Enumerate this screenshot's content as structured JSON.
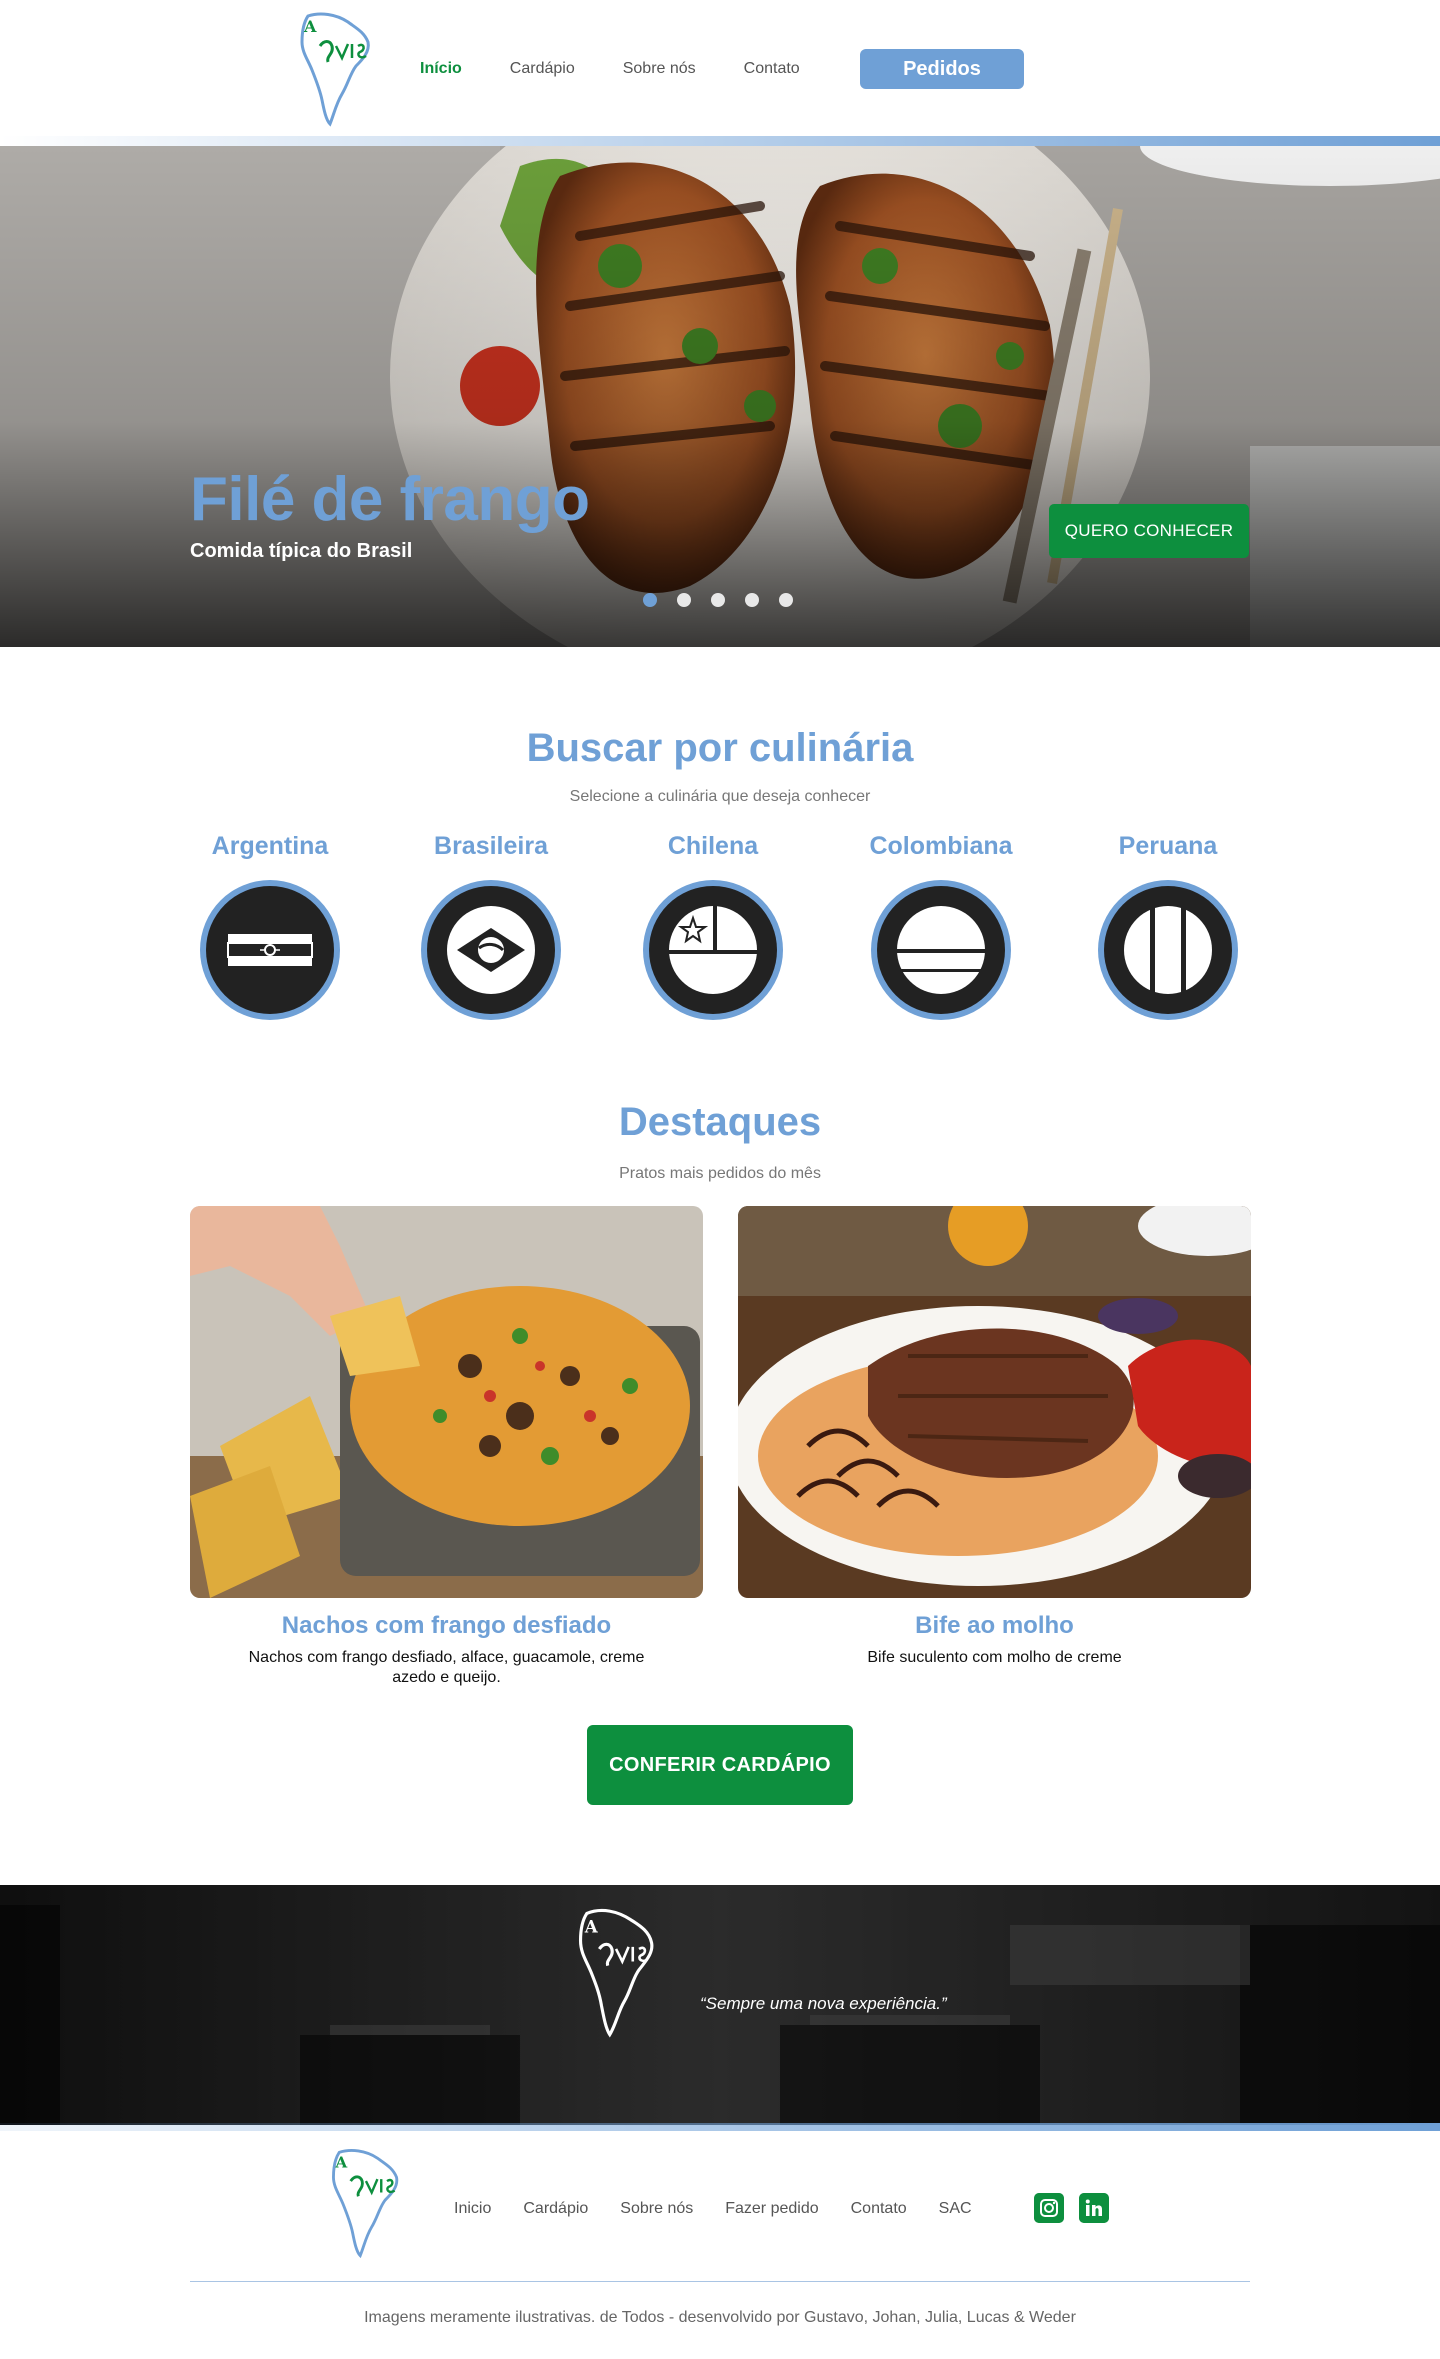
{
  "header": {
    "nav": [
      {
        "label": "Início",
        "active": true
      },
      {
        "label": "Cardápio",
        "active": false
      },
      {
        "label": "Sobre nós",
        "active": false
      },
      {
        "label": "Contato",
        "active": false
      }
    ],
    "orders_button": "Pedidos"
  },
  "hero": {
    "title": "Filé de frango",
    "subtitle": "Comida típica do Brasil",
    "cta": "QUERO CONHECER",
    "slides": 5,
    "active_slide": 1
  },
  "cuisines": {
    "title": "Buscar por culinária",
    "subtitle": "Selecione a culinária que deseja conhecer",
    "items": [
      {
        "label": "Argentina",
        "icon": "argentina-flag-icon"
      },
      {
        "label": "Brasileira",
        "icon": "brazil-flag-icon"
      },
      {
        "label": "Chilena",
        "icon": "chile-flag-icon"
      },
      {
        "label": "Colombiana",
        "icon": "colombia-flag-icon"
      },
      {
        "label": "Peruana",
        "icon": "peru-flag-icon"
      }
    ]
  },
  "highlights": {
    "title": "Destaques",
    "subtitle": "Pratos mais pedidos do mês",
    "cards": [
      {
        "title": "Nachos com frango desfiado",
        "description": "Nachos com frango desfiado, alface, guacamole, creme azedo e queijo."
      },
      {
        "title": "Bife ao molho",
        "description": "Bife suculento com molho de creme"
      }
    ],
    "menu_button": "CONFERIR CARDÁPIO"
  },
  "banner": {
    "quote": "“Sempre uma nova experiência.”"
  },
  "footer": {
    "nav": [
      "Inicio",
      "Cardápio",
      "Sobre nós",
      "Fazer pedido",
      "Contato",
      "SAC"
    ],
    "social": [
      "instagram-icon",
      "linkedin-icon"
    ],
    "copyright": "Imagens meramente ilustrativas. de Todos - desenvolvido por Gustavo, Johan, Julia, Lucas & Weder"
  },
  "colors": {
    "accent_blue": "#6fa0d6",
    "brand_green": "#0d8f3e",
    "circle_dark": "#222222"
  }
}
